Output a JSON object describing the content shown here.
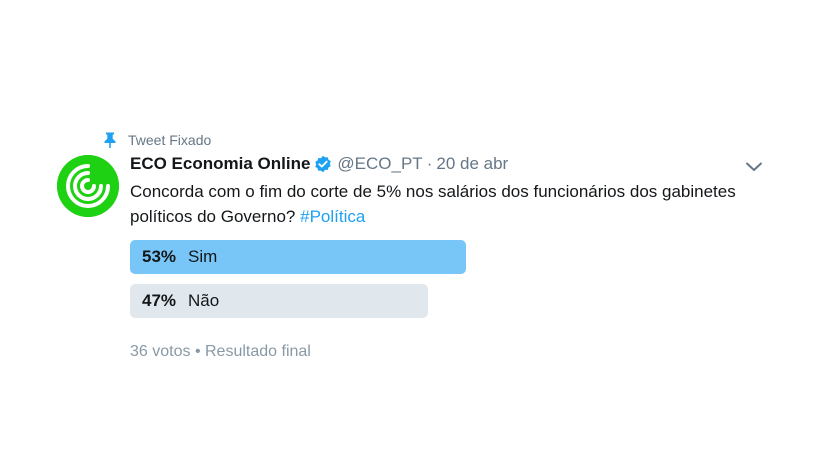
{
  "pinned": {
    "label": "Tweet Fixado",
    "icon": "pin-icon"
  },
  "author": {
    "name": "ECO Economia Online",
    "handle": "@ECO_PT",
    "date": "20 de abr",
    "separator": "·",
    "avatar_color": "#1ed112",
    "verified_color": "#1da1f2"
  },
  "tweet": {
    "text": "Concorda com o fim do corte de 5% nos salários dos funcionários dos gabinetes políticos do Governo? ",
    "hashtag": "#Política"
  },
  "poll": {
    "options": [
      {
        "percent": "53%",
        "label": "Sim",
        "fraction": 0.53,
        "color": "#78c6f7"
      },
      {
        "percent": "47%",
        "label": "Não",
        "fraction": 0.47,
        "color": "#e1e8ed"
      }
    ],
    "votes": "36 votos",
    "bullet": "•",
    "status": "Resultado final"
  },
  "colors": {
    "link": "#1da1f2",
    "muted": "#657786"
  }
}
